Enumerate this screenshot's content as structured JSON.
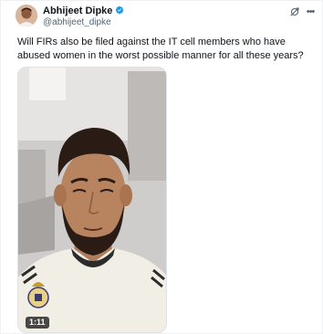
{
  "tweet": {
    "author": {
      "display_name": "Abhijeet Dipke",
      "handle": "@abhijeet_dipke",
      "verified": true
    },
    "text": "Will FIRs also be filed against the IT cell members who have abused women in the worst possible manner for all these years?",
    "media": {
      "type": "video",
      "duration": "1:11"
    }
  },
  "icons": {
    "verified": "verified-badge-icon",
    "grok": "grok-icon",
    "more": "more-options-icon"
  },
  "colors": {
    "verified_blue": "#1d9bf0",
    "text_primary": "#0f1419",
    "text_secondary": "#536471"
  }
}
